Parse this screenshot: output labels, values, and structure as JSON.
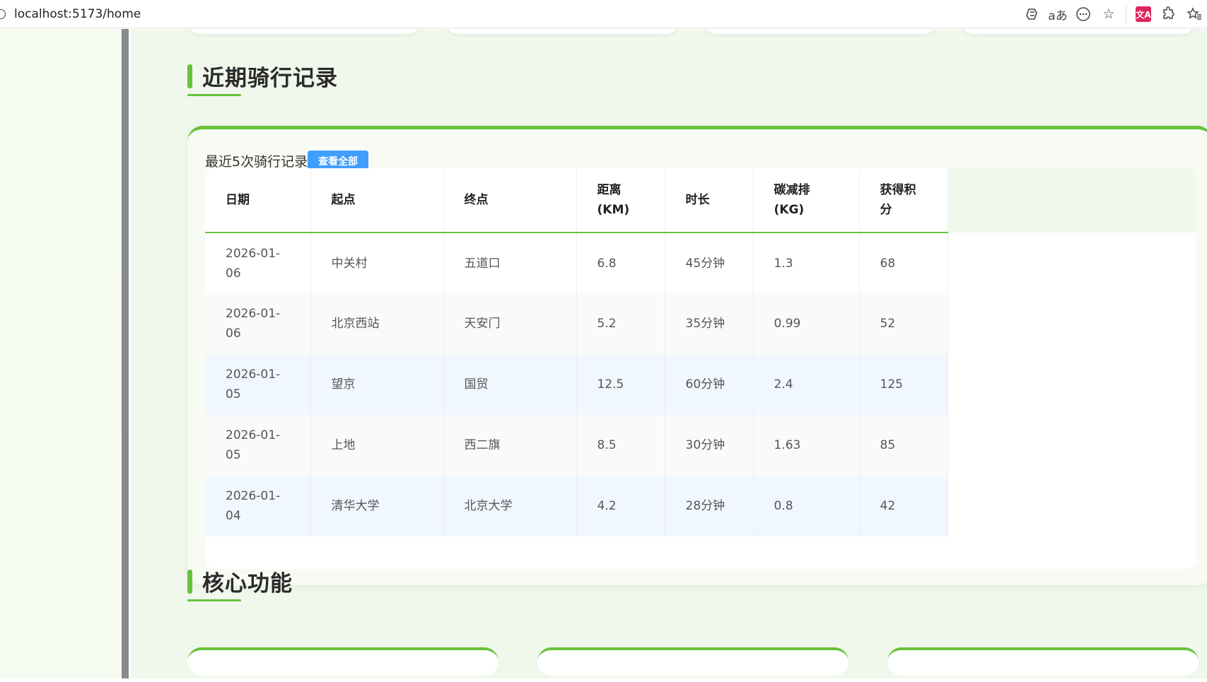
{
  "browser": {
    "url": "localhost:5173/home",
    "icons": [
      "copilot-icon",
      "translate-icon",
      "more-icon",
      "favorite-star-icon",
      "translate-extension-icon",
      "extensions-icon",
      "favorites-icon"
    ],
    "translate_badge": "文A"
  },
  "records_section": {
    "title": "近期骑行记录",
    "subtitle": "最近5次骑行记录",
    "view_all_label": "查看全部",
    "columns": [
      "日期",
      "起点",
      "终点",
      "距离(KM)",
      "时长",
      "碳减排(KG)",
      "获得积分"
    ],
    "rows": [
      {
        "date": "2026-01-06",
        "start": "中关村",
        "end": "五道口",
        "distance": "6.8",
        "duration": "45分钟",
        "carbon": "1.3",
        "points": "68"
      },
      {
        "date": "2026-01-06",
        "start": "北京西站",
        "end": "天安门",
        "distance": "5.2",
        "duration": "35分钟",
        "carbon": "0.99",
        "points": "52"
      },
      {
        "date": "2026-01-05",
        "start": "望京",
        "end": "国贸",
        "distance": "12.5",
        "duration": "60分钟",
        "carbon": "2.4",
        "points": "125"
      },
      {
        "date": "2026-01-05",
        "start": "上地",
        "end": "西二旗",
        "distance": "8.5",
        "duration": "30分钟",
        "carbon": "1.63",
        "points": "85"
      },
      {
        "date": "2026-01-04",
        "start": "清华大学",
        "end": "北京大学",
        "distance": "4.2",
        "duration": "28分钟",
        "carbon": "0.8",
        "points": "42"
      }
    ]
  },
  "features_section": {
    "title": "核心功能"
  },
  "colors": {
    "accent_green": "#67c23a",
    "button_blue": "#409eff",
    "page_bg": "#f0f7eb"
  }
}
